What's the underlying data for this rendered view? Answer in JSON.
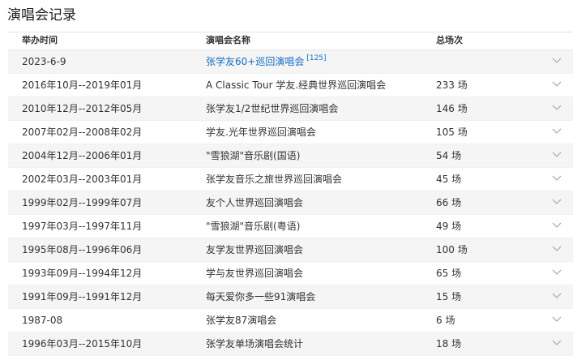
{
  "section_title": "演唱会记录",
  "table": {
    "headers": {
      "date": "举办时间",
      "name": "演唱会名称",
      "count": "总场次"
    },
    "rows": [
      {
        "date": "2023-6-9",
        "name": "张学友60+巡回演唱会",
        "ref": "[125]",
        "count": "",
        "is_link": true
      },
      {
        "date": "2016年10月--2019年01月",
        "name": "A Classic Tour 学友.经典世界巡回演唱会",
        "count": "233 场"
      },
      {
        "date": "2010年12月--2012年05月",
        "name": "张学友1/2世纪世界巡回演唱会",
        "count": "146 场"
      },
      {
        "date": "2007年02月--2008年02月",
        "name": "学友.光年世界巡回演唱会",
        "count": "105 场"
      },
      {
        "date": "2004年12月--2006年01月",
        "name": "\"雪狼湖\"音乐剧(国语)",
        "count": "54 场"
      },
      {
        "date": "2002年03月--2003年01月",
        "name": "张学友音乐之旅世界巡回演唱会",
        "count": "45 场"
      },
      {
        "date": "1999年02月--1999年07月",
        "name": "友个人世界巡回演唱会",
        "count": "66 场"
      },
      {
        "date": "1997年03月--1997年11月",
        "name": "\"雪狼湖\"音乐剧(粤语)",
        "count": "49 场"
      },
      {
        "date": "1995年08月--1996年06月",
        "name": "友学友世界巡回演唱会",
        "count": "100 场"
      },
      {
        "date": "1993年09月--1994年12月",
        "name": "学与友世界巡回演唱会",
        "count": "65 场"
      },
      {
        "date": "1991年09月--1991年12月",
        "name": "每天爱你多一些91演唱会",
        "count": "15 场"
      },
      {
        "date": "1987-08",
        "name": "张学友87演唱会",
        "count": "6 场"
      },
      {
        "date": "1996年03月--2015年10月",
        "name": "张学友单场演唱会统计",
        "count": "18 场"
      }
    ]
  },
  "icons": {
    "row_expand": "chevron-down-icon"
  },
  "colors": {
    "link": "#136ec2",
    "row_alt": "#f5f5f5",
    "chevron": "#b0b0b0"
  }
}
